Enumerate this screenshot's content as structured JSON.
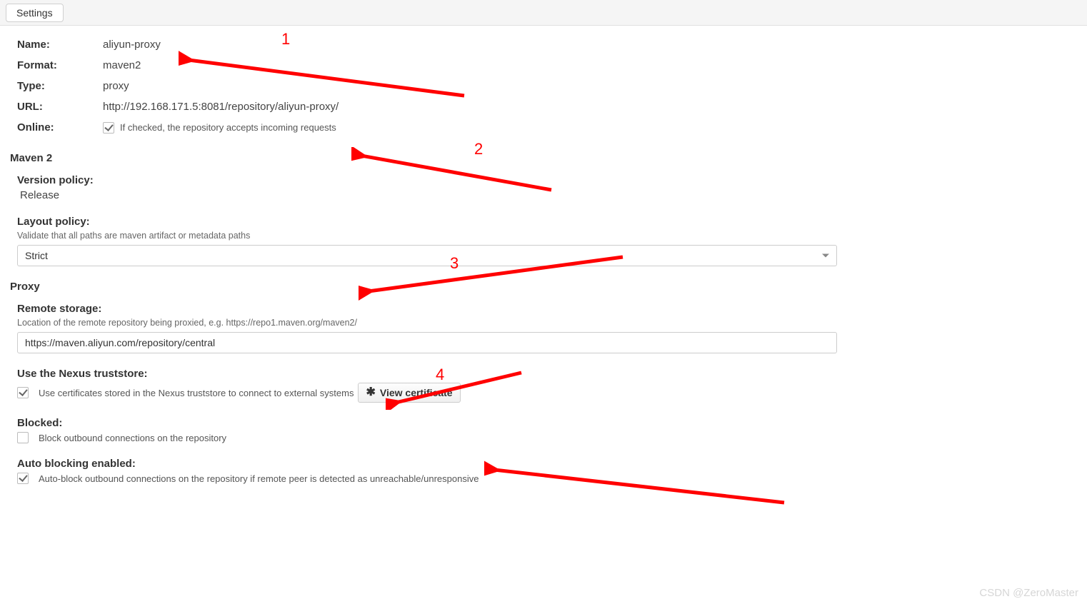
{
  "tab": {
    "label": "Settings"
  },
  "info": {
    "name_label": "Name:",
    "name_value": "aliyun-proxy",
    "format_label": "Format:",
    "format_value": "maven2",
    "type_label": "Type:",
    "type_value": "proxy",
    "url_label": "URL:",
    "url_value": "http://192.168.171.5:8081/repository/aliyun-proxy/",
    "online_label": "Online:",
    "online_help": "If checked, the repository accepts incoming requests"
  },
  "maven": {
    "header": "Maven 2",
    "version_policy_label": "Version policy:",
    "version_policy_value": "Release",
    "layout_policy_label": "Layout policy:",
    "layout_policy_desc": "Validate that all paths are maven artifact or metadata paths",
    "layout_policy_value": "Strict"
  },
  "proxy": {
    "header": "Proxy",
    "remote_storage_label": "Remote storage:",
    "remote_storage_desc": "Location of the remote repository being proxied, e.g. https://repo1.maven.org/maven2/",
    "remote_storage_value": "https://maven.aliyun.com/repository/central",
    "truststore_label": "Use the Nexus truststore:",
    "truststore_help": "Use certificates stored in the Nexus truststore to connect to external systems",
    "view_cert_label": "View certificate",
    "blocked_label": "Blocked:",
    "blocked_help": "Block outbound connections on the repository",
    "auto_block_label": "Auto blocking enabled:",
    "auto_block_help": "Auto-block outbound connections on the repository if remote peer is detected as unreachable/unresponsive"
  },
  "annotations": {
    "n1": "1",
    "n2": "2",
    "n3": "3",
    "n4": "4"
  },
  "watermark": "CSDN @ZeroMaster"
}
